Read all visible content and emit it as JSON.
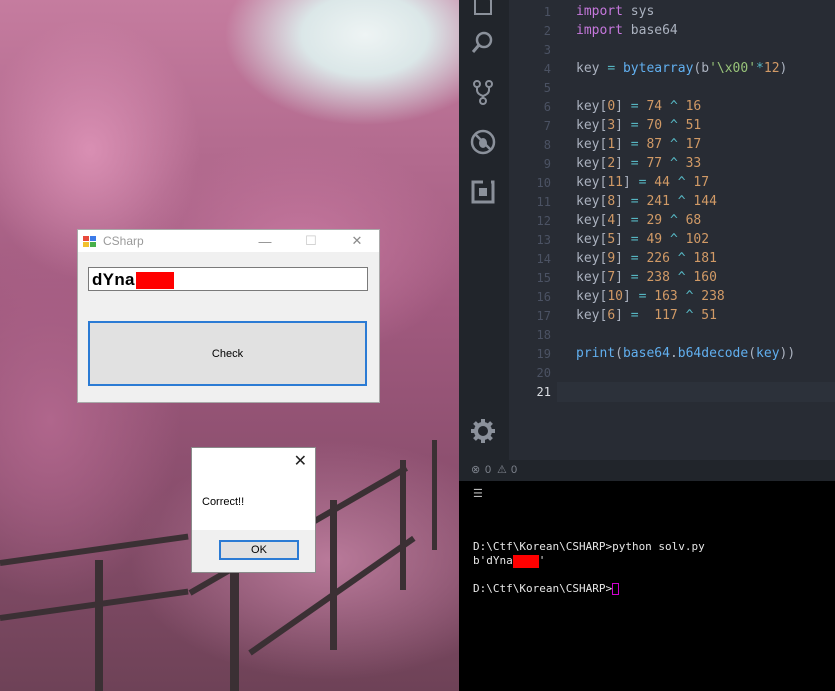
{
  "csharp_window": {
    "title": "CSharp",
    "input_value": "dYna",
    "check_label": "Check",
    "minimize_glyph": "—",
    "maximize_glyph": "☐",
    "close_glyph": "✕"
  },
  "message_box": {
    "text": "Correct!!",
    "ok_label": "OK",
    "close_glyph": "✕"
  },
  "editor": {
    "line_numbers": [
      "1",
      "2",
      "3",
      "4",
      "5",
      "6",
      "7",
      "8",
      "9",
      "10",
      "11",
      "12",
      "13",
      "14",
      "15",
      "16",
      "17",
      "18",
      "19",
      "20",
      "21"
    ],
    "active_line": "21",
    "status": {
      "errors": "0",
      "warnings": "0"
    }
  },
  "terminal": {
    "menu_glyph": "☰",
    "command_line": "D:\\Ctf\\Korean\\CSHARP>python solv.py",
    "output_prefix": "b'dYna",
    "output_suffix": "'",
    "prompt": "D:\\Ctf\\Korean\\CSHARP>"
  },
  "colors": {
    "accent_blue": "#2b7bd4",
    "redaction": "#ff0000",
    "editor_bg": "#282c34"
  },
  "icons": [
    "explorer-icon",
    "search-icon",
    "source-control-icon",
    "debug-icon",
    "extensions-icon",
    "gear-icon",
    "error-icon",
    "warning-icon"
  ]
}
